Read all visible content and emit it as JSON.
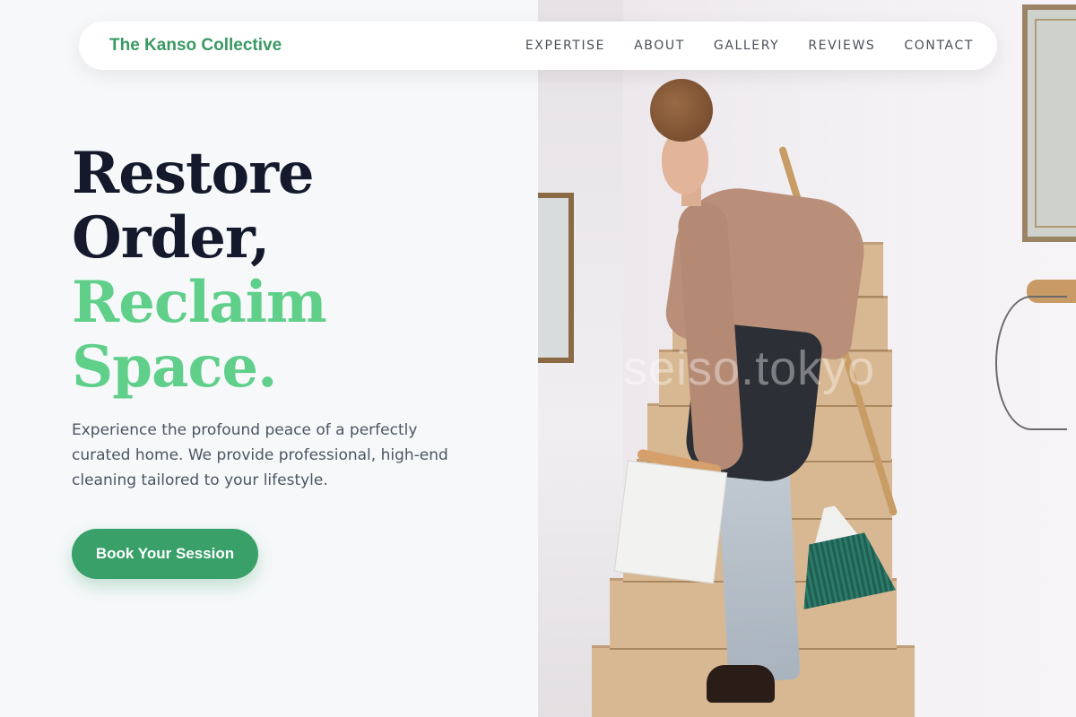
{
  "nav": {
    "brand": "The Kanso Collective",
    "links": [
      "EXPERTISE",
      "ABOUT",
      "GALLERY",
      "REVIEWS",
      "CONTACT"
    ]
  },
  "hero": {
    "headline_line1": "Restore",
    "headline_line2": "Order,",
    "headline_line3": "Reclaim",
    "headline_line4": "Space.",
    "subtitle": "Experience the profound peace of a perfectly curated home. We provide professional, high-end cleaning tailored to your lifestyle.",
    "cta_label": "Book Your Session"
  },
  "photo": {
    "watermark": "seiso.tokyo"
  },
  "colors": {
    "brand_green": "#3a9a63",
    "accent_green": "#5fcf8a",
    "button_green": "#38a068",
    "heading_dark": "#141a2b"
  }
}
